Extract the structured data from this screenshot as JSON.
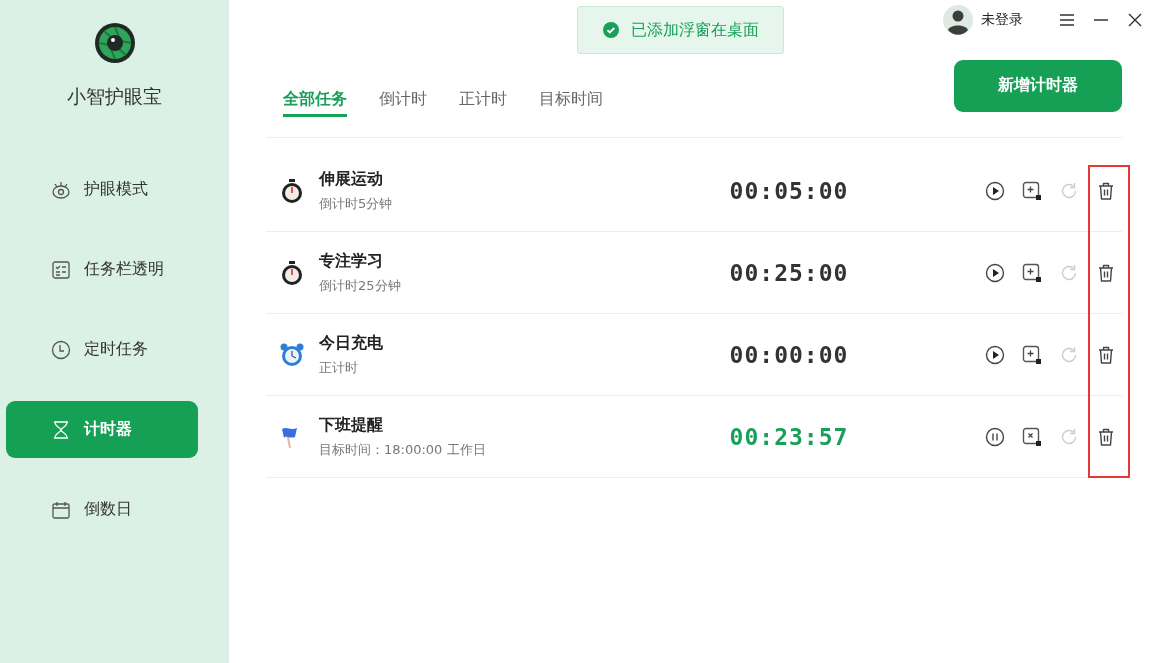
{
  "app": {
    "name": "小智护眼宝"
  },
  "sidebar": {
    "items": [
      {
        "label": "护眼模式",
        "kind": "eye",
        "selected": false
      },
      {
        "label": "任务栏透明",
        "kind": "taskbar",
        "selected": false
      },
      {
        "label": "定时任务",
        "kind": "clock",
        "selected": false
      },
      {
        "label": "计时器",
        "kind": "hourglass",
        "selected": true
      },
      {
        "label": "倒数日",
        "kind": "calendar",
        "selected": false
      }
    ]
  },
  "toast": {
    "text": "已添加浮窗在桌面"
  },
  "user": {
    "label": "未登录"
  },
  "tabs": [
    {
      "label": "全部任务",
      "selected": true
    },
    {
      "label": "倒计时",
      "selected": false
    },
    {
      "label": "正计时",
      "selected": false
    },
    {
      "label": "目标时间",
      "selected": false
    }
  ],
  "new_button": {
    "label": "新增计时器"
  },
  "tasks": [
    {
      "kind": "stopwatch",
      "title": "伸展运动",
      "subtitle": "倒计时5分钟",
      "time": "00:05:00",
      "running": false
    },
    {
      "kind": "stopwatch",
      "title": "专注学习",
      "subtitle": "倒计时25分钟",
      "time": "00:25:00",
      "running": false
    },
    {
      "kind": "alarm",
      "title": "今日充电",
      "subtitle": "正计时",
      "time": "00:00:00",
      "running": false
    },
    {
      "kind": "flag",
      "title": "下班提醒",
      "subtitle": "目标时间：18:00:00 工作日",
      "time": "00:23:57",
      "running": true
    }
  ],
  "delete_column_highlighted": true
}
